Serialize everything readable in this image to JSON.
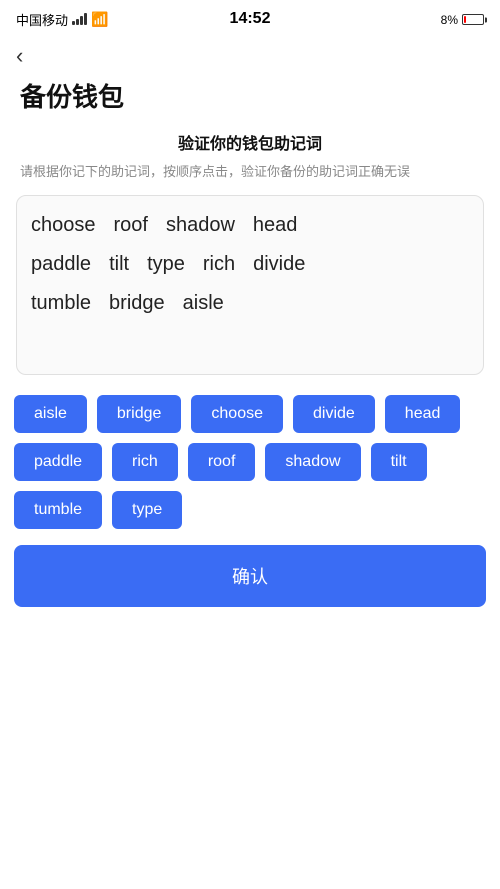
{
  "statusBar": {
    "carrier": "中国移动",
    "time": "14:52",
    "batteryPercent": "8%"
  },
  "backButton": "‹",
  "pageTitle": "备份钱包",
  "sectionTitle": "验证你的钱包助记词",
  "sectionSubtitle": "请根据你记下的助记词，按顺序点击，验证你备份的助记词正确无误",
  "wordGrid": {
    "rows": [
      [
        "choose",
        "roof",
        "shadow",
        "head"
      ],
      [
        "paddle",
        "tilt",
        "type",
        "rich",
        "divide"
      ],
      [
        "tumble",
        "bridge",
        "aisle"
      ]
    ]
  },
  "tags": [
    "aisle",
    "bridge",
    "choose",
    "divide",
    "head",
    "paddle",
    "rich",
    "roof",
    "shadow",
    "tilt",
    "tumble",
    "type"
  ],
  "confirmButton": "确认",
  "colors": {
    "accent": "#3a6cf4",
    "tagBg": "#3a6cf4",
    "tagText": "#ffffff"
  }
}
